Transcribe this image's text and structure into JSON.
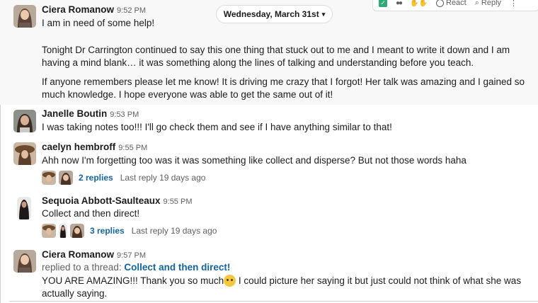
{
  "date_divider": {
    "label": "Wednesday, March 31st"
  },
  "toolbar": {
    "react_label": "React",
    "reply_label": "Reply"
  },
  "messages": [
    {
      "author": "Ciera Romanow",
      "time": "9:52 PM",
      "paragraphs": [
        "I am in need of some help!",
        "Tonight Dr Carrington continued to say this one thing that stuck out to me and I meant to write it down and I am having a mind blank… it was something along the lines of talking and understanding before you teach.",
        "If anyone remembers please let me know! It is driving me crazy that I forgot! Her talk was amazing and I gained so much knowledge. I hope everyone was able to get the same out of it!"
      ]
    },
    {
      "author": "Janelle Boutin",
      "time": "9:53 PM",
      "text": "I was taking notes too!!! I'll go check them and see if I have anything similar to that!"
    },
    {
      "author": "caelyn hembroff",
      "time": "9:55 PM",
      "text": "Ahh now I'm forgetting too was it was something like collect and disperse? But not those words haha",
      "thread": {
        "replies": "2 replies",
        "last": "Last reply 19 days ago"
      }
    },
    {
      "author": "Sequoia Abbott-Saulteaux",
      "time": "9:55 PM",
      "text": "Collect and then direct!",
      "thread": {
        "replies": "3 replies",
        "last": "Last reply 19 days ago"
      }
    },
    {
      "author": "Ciera Romanow",
      "time": "9:57 PM",
      "replied_prefix": "replied to a thread:",
      "replied_link": "Collect and then direct!",
      "text_before_emoji": "YOU ARE AMAZING!!! Thank you so much",
      "text_after_emoji": " I could picture her saying it but just could not think of what she was actually saying."
    }
  ],
  "colors": {
    "link": "#1264a3",
    "hover_bg": "#f8f8f8",
    "check": "#2bac76"
  }
}
